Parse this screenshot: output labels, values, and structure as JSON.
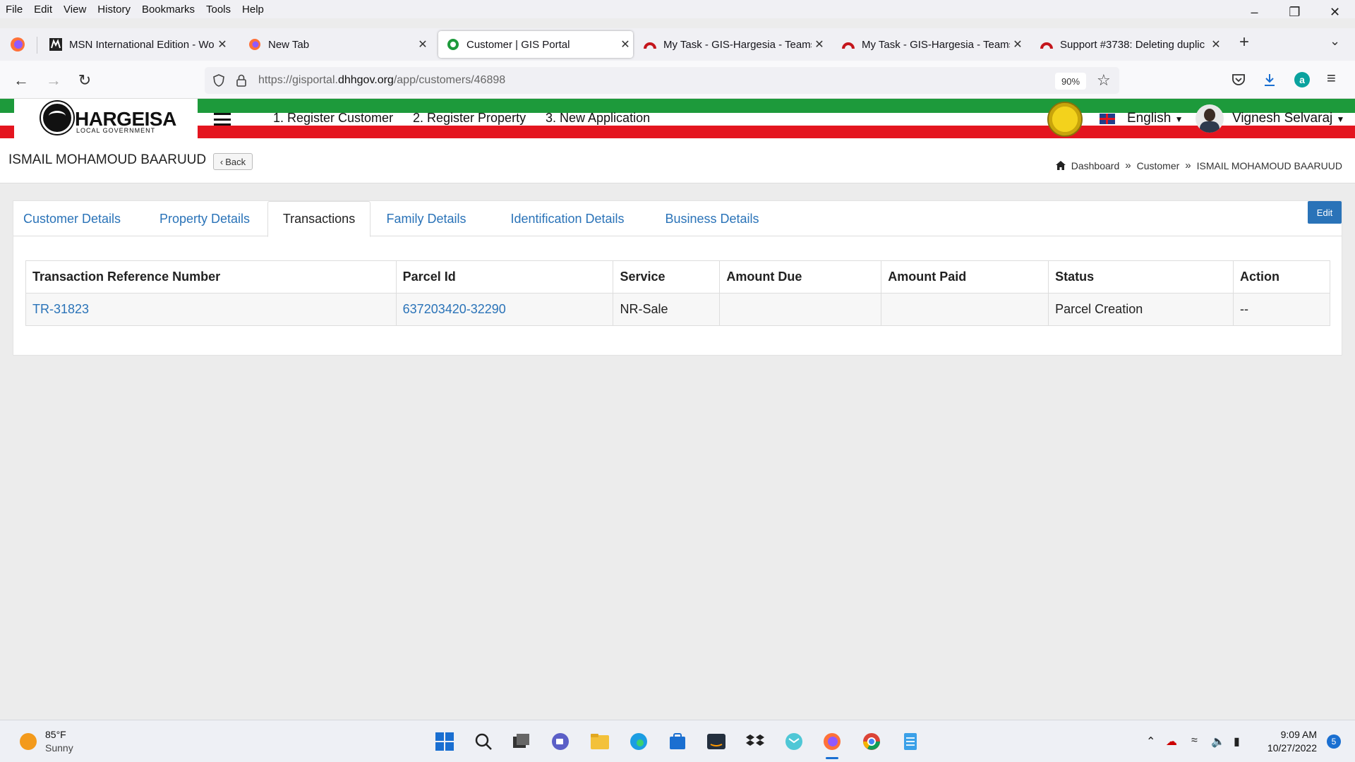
{
  "browser": {
    "menu": [
      "File",
      "Edit",
      "View",
      "History",
      "Bookmarks",
      "Tools",
      "Help"
    ],
    "tabs": [
      {
        "title": "MSN International Edition - Wor",
        "icon": "msn-icon"
      },
      {
        "title": "New Tab",
        "icon": "firefox-icon"
      },
      {
        "title": "Customer | GIS Portal",
        "icon": "gis-portal-icon",
        "active": true
      },
      {
        "title": "My Task - GIS-Hargesia - Teams",
        "icon": "redmine-icon"
      },
      {
        "title": "My Task - GIS-Hargesia - Teams",
        "icon": "redmine-icon"
      },
      {
        "title": "Support #3738: Deleting duplic",
        "icon": "redmine-icon"
      }
    ],
    "url_prefix": "https://gisportal.",
    "url_domain": "dhhgov.org",
    "url_path": "/app/customers/46898",
    "zoom": "90%"
  },
  "site": {
    "logo_text": "HARGEISA",
    "logo_subtext": "LOCAL GOVERNMENT",
    "nav": [
      "1. Register Customer",
      "2. Register Property",
      "3. New Application"
    ],
    "language": "English",
    "user_name": "Vignesh Selvaraj"
  },
  "page": {
    "title": "ISMAIL MOHAMOUD BAARUUD",
    "back_label": "Back",
    "breadcrumb": [
      "Dashboard",
      "Customer",
      "ISMAIL MOHAMOUD BAARUUD"
    ]
  },
  "tabs": [
    {
      "label": "Customer Details"
    },
    {
      "label": "Property Details"
    },
    {
      "label": "Transactions",
      "active": true
    },
    {
      "label": "Family Details"
    },
    {
      "label": "Identification Details"
    },
    {
      "label": "Business Details"
    }
  ],
  "edit_label": "Edit",
  "table": {
    "headers": [
      "Transaction Reference Number",
      "Parcel Id",
      "Service",
      "Amount Due",
      "Amount Paid",
      "Status",
      "Action"
    ],
    "rows": [
      {
        "ref": "TR-31823",
        "parcel": "637203420-32290",
        "service": "NR-Sale",
        "due": "",
        "paid": "",
        "status": "Parcel Creation",
        "action": "--"
      }
    ]
  },
  "taskbar": {
    "temperature": "85°F",
    "condition": "Sunny",
    "time": "9:09 AM",
    "date": "10/27/2022",
    "notifications": "5"
  },
  "colors": {
    "accent": "#2a73b8",
    "header_green": "#1d9a3b",
    "header_red": "#e4151f"
  }
}
